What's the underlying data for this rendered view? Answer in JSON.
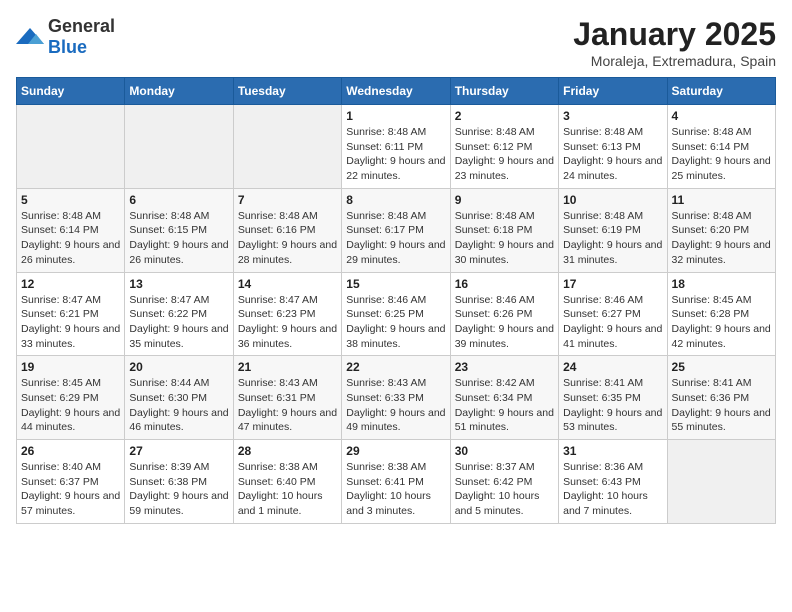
{
  "logo": {
    "general": "General",
    "blue": "Blue"
  },
  "title": "January 2025",
  "subtitle": "Moraleja, Extremadura, Spain",
  "weekdays": [
    "Sunday",
    "Monday",
    "Tuesday",
    "Wednesday",
    "Thursday",
    "Friday",
    "Saturday"
  ],
  "weeks": [
    [
      null,
      null,
      null,
      {
        "day": 1,
        "sunrise": "8:48 AM",
        "sunset": "6:11 PM",
        "daylight": "9 hours and 22 minutes."
      },
      {
        "day": 2,
        "sunrise": "8:48 AM",
        "sunset": "6:12 PM",
        "daylight": "9 hours and 23 minutes."
      },
      {
        "day": 3,
        "sunrise": "8:48 AM",
        "sunset": "6:13 PM",
        "daylight": "9 hours and 24 minutes."
      },
      {
        "day": 4,
        "sunrise": "8:48 AM",
        "sunset": "6:14 PM",
        "daylight": "9 hours and 25 minutes."
      }
    ],
    [
      {
        "day": 5,
        "sunrise": "8:48 AM",
        "sunset": "6:14 PM",
        "daylight": "9 hours and 26 minutes."
      },
      {
        "day": 6,
        "sunrise": "8:48 AM",
        "sunset": "6:15 PM",
        "daylight": "9 hours and 26 minutes."
      },
      {
        "day": 7,
        "sunrise": "8:48 AM",
        "sunset": "6:16 PM",
        "daylight": "9 hours and 28 minutes."
      },
      {
        "day": 8,
        "sunrise": "8:48 AM",
        "sunset": "6:17 PM",
        "daylight": "9 hours and 29 minutes."
      },
      {
        "day": 9,
        "sunrise": "8:48 AM",
        "sunset": "6:18 PM",
        "daylight": "9 hours and 30 minutes."
      },
      {
        "day": 10,
        "sunrise": "8:48 AM",
        "sunset": "6:19 PM",
        "daylight": "9 hours and 31 minutes."
      },
      {
        "day": 11,
        "sunrise": "8:48 AM",
        "sunset": "6:20 PM",
        "daylight": "9 hours and 32 minutes."
      }
    ],
    [
      {
        "day": 12,
        "sunrise": "8:47 AM",
        "sunset": "6:21 PM",
        "daylight": "9 hours and 33 minutes."
      },
      {
        "day": 13,
        "sunrise": "8:47 AM",
        "sunset": "6:22 PM",
        "daylight": "9 hours and 35 minutes."
      },
      {
        "day": 14,
        "sunrise": "8:47 AM",
        "sunset": "6:23 PM",
        "daylight": "9 hours and 36 minutes."
      },
      {
        "day": 15,
        "sunrise": "8:46 AM",
        "sunset": "6:25 PM",
        "daylight": "9 hours and 38 minutes."
      },
      {
        "day": 16,
        "sunrise": "8:46 AM",
        "sunset": "6:26 PM",
        "daylight": "9 hours and 39 minutes."
      },
      {
        "day": 17,
        "sunrise": "8:46 AM",
        "sunset": "6:27 PM",
        "daylight": "9 hours and 41 minutes."
      },
      {
        "day": 18,
        "sunrise": "8:45 AM",
        "sunset": "6:28 PM",
        "daylight": "9 hours and 42 minutes."
      }
    ],
    [
      {
        "day": 19,
        "sunrise": "8:45 AM",
        "sunset": "6:29 PM",
        "daylight": "9 hours and 44 minutes."
      },
      {
        "day": 20,
        "sunrise": "8:44 AM",
        "sunset": "6:30 PM",
        "daylight": "9 hours and 46 minutes."
      },
      {
        "day": 21,
        "sunrise": "8:43 AM",
        "sunset": "6:31 PM",
        "daylight": "9 hours and 47 minutes."
      },
      {
        "day": 22,
        "sunrise": "8:43 AM",
        "sunset": "6:33 PM",
        "daylight": "9 hours and 49 minutes."
      },
      {
        "day": 23,
        "sunrise": "8:42 AM",
        "sunset": "6:34 PM",
        "daylight": "9 hours and 51 minutes."
      },
      {
        "day": 24,
        "sunrise": "8:41 AM",
        "sunset": "6:35 PM",
        "daylight": "9 hours and 53 minutes."
      },
      {
        "day": 25,
        "sunrise": "8:41 AM",
        "sunset": "6:36 PM",
        "daylight": "9 hours and 55 minutes."
      }
    ],
    [
      {
        "day": 26,
        "sunrise": "8:40 AM",
        "sunset": "6:37 PM",
        "daylight": "9 hours and 57 minutes."
      },
      {
        "day": 27,
        "sunrise": "8:39 AM",
        "sunset": "6:38 PM",
        "daylight": "9 hours and 59 minutes."
      },
      {
        "day": 28,
        "sunrise": "8:38 AM",
        "sunset": "6:40 PM",
        "daylight": "10 hours and 1 minute."
      },
      {
        "day": 29,
        "sunrise": "8:38 AM",
        "sunset": "6:41 PM",
        "daylight": "10 hours and 3 minutes."
      },
      {
        "day": 30,
        "sunrise": "8:37 AM",
        "sunset": "6:42 PM",
        "daylight": "10 hours and 5 minutes."
      },
      {
        "day": 31,
        "sunrise": "8:36 AM",
        "sunset": "6:43 PM",
        "daylight": "10 hours and 7 minutes."
      },
      null
    ]
  ]
}
